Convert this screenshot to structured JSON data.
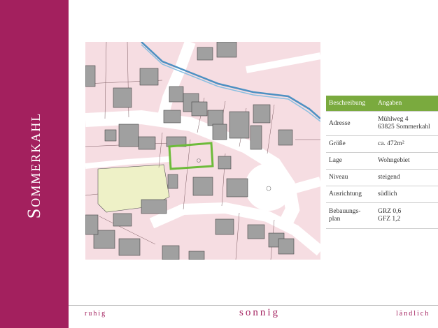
{
  "sidebar": {
    "title": "Sommerkahl"
  },
  "table": {
    "header": {
      "col1": "Beschreibung",
      "col2": "Angaben"
    },
    "rows": [
      {
        "label": "Adresse",
        "value_line1": "Mühlweg 4",
        "value_line2": "63825 Sommerkahl"
      },
      {
        "label": "Größe",
        "value": "ca. 472m²"
      },
      {
        "label": "Lage",
        "value": "Wohngebiet"
      },
      {
        "label": "Niveau",
        "value": "steigend"
      },
      {
        "label": "Ausrichtung",
        "value": "südlich"
      },
      {
        "label_line1": "Bebauungs-",
        "label_line2": "plan",
        "value_line1": "GRZ 0,6",
        "value_line2": "GFZ 1,2"
      }
    ]
  },
  "footer": {
    "left": "ruhig",
    "center": "sonnig",
    "right": "ländlich"
  },
  "colors": {
    "brand": "#a3205e",
    "table_header": "#7aaa3e",
    "parcel_outline": "#6dbb3a",
    "parcels": "#f6dde2",
    "buildings": "#a0a0a0",
    "green_area": "#eef1c7",
    "river": "#4d90c2"
  }
}
